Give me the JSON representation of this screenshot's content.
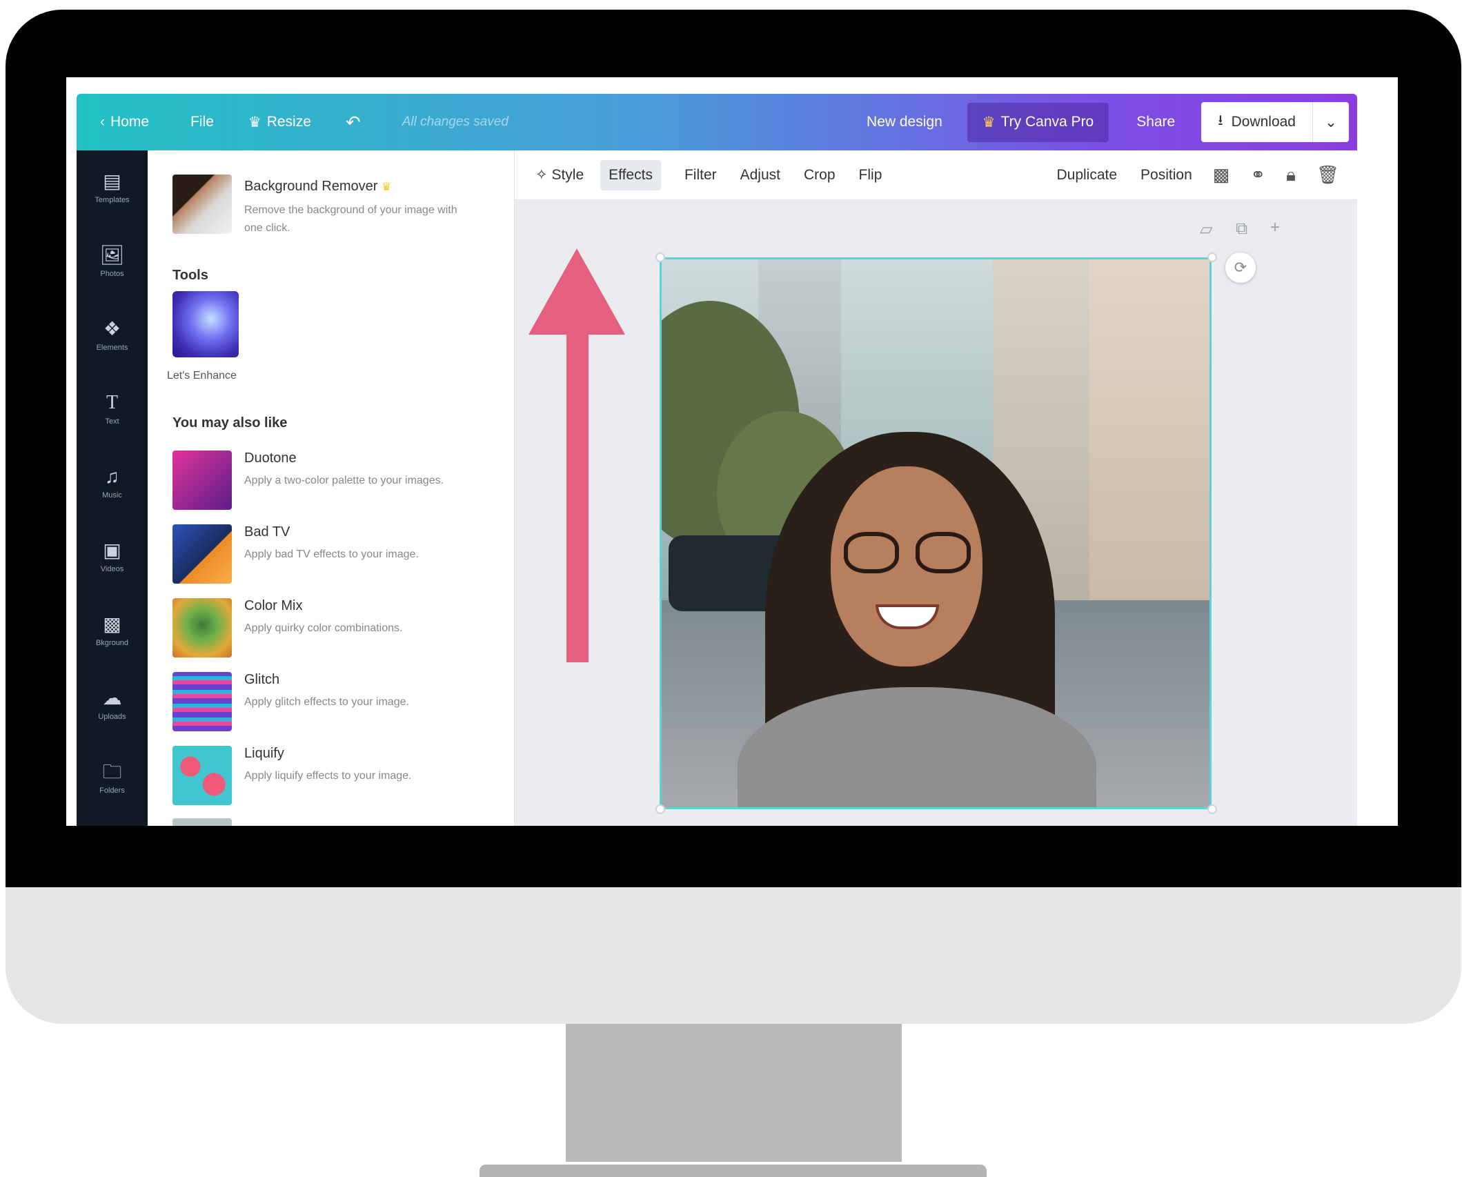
{
  "header": {
    "home": "Home",
    "file": "File",
    "resize": "Resize",
    "saved": "All changes saved",
    "new_design": "New design",
    "try_pro": "Try Canva Pro",
    "share": "Share",
    "download": "Download"
  },
  "rail": [
    {
      "label": "Templates",
      "icon": "▤"
    },
    {
      "label": "Photos",
      "icon": "🖼"
    },
    {
      "label": "Elements",
      "icon": "❖"
    },
    {
      "label": "Text",
      "icon": "T"
    },
    {
      "label": "Music",
      "icon": "♫"
    },
    {
      "label": "Videos",
      "icon": "▣"
    },
    {
      "label": "Bkground",
      "icon": "▩"
    },
    {
      "label": "Uploads",
      "icon": "☁"
    },
    {
      "label": "Folders",
      "icon": "🗀"
    }
  ],
  "panel": {
    "bg_remover": {
      "title": "Background Remover",
      "desc": "Remove the background of your image with one click."
    },
    "tools_heading": "Tools",
    "tool_label": "Let's Enhance",
    "also_like_heading": "You may also like",
    "effects": [
      {
        "title": "Duotone",
        "desc": "Apply a two-color palette to your images.",
        "color": "#c23b8f"
      },
      {
        "title": "Bad TV",
        "desc": "Apply bad TV effects to your image.",
        "color": "#3a5fa8"
      },
      {
        "title": "Color Mix",
        "desc": "Apply quirky color combinations.",
        "color": "#d4a83c"
      },
      {
        "title": "Glitch",
        "desc": "Apply glitch effects to your image.",
        "color": "#7a4bc9"
      },
      {
        "title": "Liquify",
        "desc": "Apply liquify effects to your image.",
        "color": "#41b8c4"
      }
    ]
  },
  "toolbar": {
    "style": "Style",
    "effects": "Effects",
    "filter": "Filter",
    "adjust": "Adjust",
    "crop": "Crop",
    "flip": "Flip",
    "duplicate": "Duplicate",
    "position": "Position"
  },
  "colors": {
    "accent": "#59d2d8",
    "arrow": "#e5607e"
  }
}
